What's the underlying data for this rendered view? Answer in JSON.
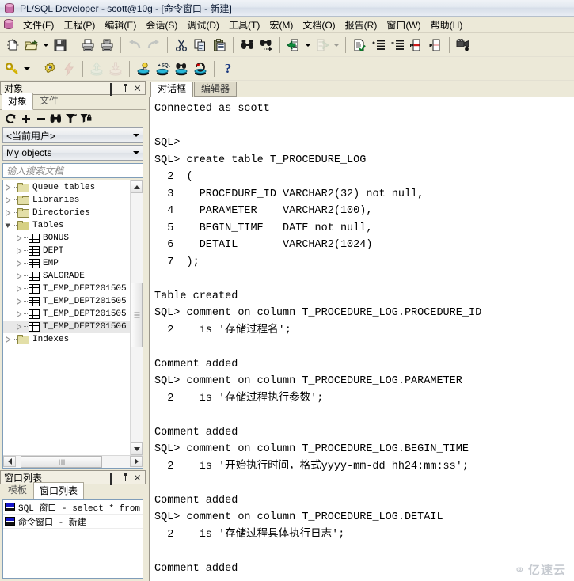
{
  "window": {
    "title": "PL/SQL Developer - scott@10g - [命令窗口 - 新建]",
    "app_icon": "database-icon"
  },
  "menubar": {
    "icon": "database-icon",
    "items": [
      {
        "label": "文件(F)",
        "name": "menu-file"
      },
      {
        "label": "工程(P)",
        "name": "menu-project"
      },
      {
        "label": "编辑(E)",
        "name": "menu-edit"
      },
      {
        "label": "会话(S)",
        "name": "menu-session"
      },
      {
        "label": "调试(D)",
        "name": "menu-debug"
      },
      {
        "label": "工具(T)",
        "name": "menu-tools"
      },
      {
        "label": "宏(M)",
        "name": "menu-macro"
      },
      {
        "label": "文档(O)",
        "name": "menu-document"
      },
      {
        "label": "报告(R)",
        "name": "menu-report"
      },
      {
        "label": "窗口(W)",
        "name": "menu-window"
      },
      {
        "label": "帮助(H)",
        "name": "menu-help"
      }
    ]
  },
  "toolbar_main": {
    "buttons": [
      {
        "name": "new-icon",
        "glyph": "new",
        "enabled": true
      },
      {
        "name": "open-icon",
        "glyph": "open",
        "enabled": true
      },
      {
        "name": "open-dropdown-arrow",
        "glyph": "caret",
        "enabled": true
      },
      {
        "name": "save-icon",
        "glyph": "save",
        "enabled": true
      },
      {
        "name": "sep",
        "glyph": "sep"
      },
      {
        "name": "print-icon",
        "glyph": "print",
        "enabled": true
      },
      {
        "name": "print-preview-icon",
        "glyph": "printpreview",
        "enabled": true
      },
      {
        "name": "sep",
        "glyph": "sep"
      },
      {
        "name": "undo-icon",
        "glyph": "undo",
        "enabled": false
      },
      {
        "name": "redo-icon",
        "glyph": "redo",
        "enabled": false
      },
      {
        "name": "sep",
        "glyph": "sep"
      },
      {
        "name": "cut-icon",
        "glyph": "cut",
        "enabled": true
      },
      {
        "name": "copy-icon",
        "glyph": "copy",
        "enabled": true
      },
      {
        "name": "paste-icon",
        "glyph": "paste",
        "enabled": true
      },
      {
        "name": "sep",
        "glyph": "sep"
      },
      {
        "name": "find-icon",
        "glyph": "find",
        "enabled": true
      },
      {
        "name": "find-next-icon",
        "glyph": "findnext",
        "enabled": true
      },
      {
        "name": "sep",
        "glyph": "sep"
      },
      {
        "name": "import-icon",
        "glyph": "import",
        "enabled": true
      },
      {
        "name": "import-dropdown-arrow",
        "glyph": "caret",
        "enabled": true
      },
      {
        "name": "export-icon",
        "glyph": "export",
        "enabled": false
      },
      {
        "name": "export-dropdown-arrow",
        "glyph": "caret",
        "enabled": false
      },
      {
        "name": "sep",
        "glyph": "sep"
      },
      {
        "name": "check-syntax-icon",
        "glyph": "checkdoc",
        "enabled": true
      },
      {
        "name": "indent-icon",
        "glyph": "indent",
        "enabled": true
      },
      {
        "name": "outdent-icon",
        "glyph": "outdent",
        "enabled": true
      },
      {
        "name": "comment-icon",
        "glyph": "commentdoc",
        "enabled": true
      },
      {
        "name": "uncomment-icon",
        "glyph": "uncommentdoc",
        "enabled": true
      },
      {
        "name": "sep",
        "glyph": "sep"
      },
      {
        "name": "record-macro-icon",
        "glyph": "camera",
        "enabled": true
      }
    ]
  },
  "toolbar_secondary": {
    "buttons": [
      {
        "name": "explain-plan-icon",
        "glyph": "key",
        "enabled": true
      },
      {
        "name": "key-dropdown-arrow",
        "glyph": "caret",
        "enabled": true
      },
      {
        "name": "sep",
        "glyph": "sep"
      },
      {
        "name": "execute-icon",
        "glyph": "gear",
        "enabled": true
      },
      {
        "name": "break-icon",
        "glyph": "bolt",
        "enabled": false
      },
      {
        "name": "sep",
        "glyph": "sep"
      },
      {
        "name": "commit-icon",
        "glyph": "commit",
        "enabled": false
      },
      {
        "name": "rollback-icon",
        "glyph": "rollback",
        "enabled": false
      },
      {
        "name": "sep",
        "glyph": "sep"
      },
      {
        "name": "explain-plan-window-icon",
        "glyph": "db-bulb",
        "enabled": true
      },
      {
        "name": "sql-window-icon",
        "glyph": "db-sql",
        "enabled": true
      },
      {
        "name": "find-database-objects-icon",
        "glyph": "db-find",
        "enabled": true
      },
      {
        "name": "session-icon",
        "glyph": "db-session",
        "enabled": true
      },
      {
        "name": "sep",
        "glyph": "sep"
      },
      {
        "name": "help-icon",
        "glyph": "question",
        "enabled": true
      }
    ]
  },
  "object_panel": {
    "caption": "对象",
    "caption_buttons": [
      "maximize-icon",
      "pin-icon",
      "close-icon"
    ],
    "tabs": [
      {
        "label": "对象",
        "selected": true
      },
      {
        "label": "文件",
        "selected": false
      }
    ],
    "toolbar": [
      {
        "name": "refresh-icon",
        "glyph": "refresh"
      },
      {
        "name": "expand-icon",
        "glyph": "plus"
      },
      {
        "name": "collapse-icon",
        "glyph": "minus"
      },
      {
        "name": "find-icon",
        "glyph": "binoculars"
      },
      {
        "name": "filter-icon",
        "glyph": "filter"
      },
      {
        "name": "lock-filter-icon",
        "glyph": "filter-lock"
      }
    ],
    "user_combo": "<当前用户>",
    "filter_combo": "My objects",
    "search_placeholder": "输入搜索文档",
    "tree": [
      {
        "label": "Queue tables",
        "icon": "folder-icon",
        "indent": 0,
        "expanded": false
      },
      {
        "label": "Libraries",
        "icon": "folder-icon",
        "indent": 0,
        "expanded": false
      },
      {
        "label": "Directories",
        "icon": "folder-icon",
        "indent": 0,
        "expanded": false
      },
      {
        "label": "Tables",
        "icon": "folder-open-icon",
        "indent": 0,
        "expanded": true
      },
      {
        "label": "BONUS",
        "icon": "table-icon",
        "indent": 1,
        "expanded": false
      },
      {
        "label": "DEPT",
        "icon": "table-icon",
        "indent": 1,
        "expanded": false
      },
      {
        "label": "EMP",
        "icon": "table-icon",
        "indent": 1,
        "expanded": false
      },
      {
        "label": "SALGRADE",
        "icon": "table-icon",
        "indent": 1,
        "expanded": false
      },
      {
        "label": "T_EMP_DEPT201505",
        "icon": "table-icon",
        "indent": 1,
        "expanded": false
      },
      {
        "label": "T_EMP_DEPT201505",
        "icon": "table-icon",
        "indent": 1,
        "expanded": false
      },
      {
        "label": "T_EMP_DEPT201505",
        "icon": "table-icon",
        "indent": 1,
        "expanded": false
      },
      {
        "label": "T_EMP_DEPT201506",
        "icon": "table-icon",
        "indent": 1,
        "expanded": false,
        "selected": true
      },
      {
        "label": "Indexes",
        "icon": "folder-icon",
        "indent": 0,
        "expanded": false
      }
    ]
  },
  "window_list_panel": {
    "caption": "窗口列表",
    "caption_buttons": [
      "maximize-icon",
      "pin-icon",
      "close-icon"
    ],
    "tabs": [
      {
        "label": "模板",
        "selected": false
      },
      {
        "label": "窗口列表",
        "selected": true
      }
    ],
    "items": [
      {
        "label": "SQL 窗口 - select * from t_",
        "icon": "window-icon"
      },
      {
        "label": "命令窗口 - 新建",
        "icon": "window-icon"
      }
    ]
  },
  "editor": {
    "tabs": [
      {
        "label": "对话框",
        "selected": true
      },
      {
        "label": "编辑器",
        "selected": false
      }
    ],
    "console_lines": [
      "Connected as scott",
      "",
      "SQL>",
      "SQL> create table T_PROCEDURE_LOG",
      "  2  (",
      "  3    PROCEDURE_ID VARCHAR2(32) not null,",
      "  4    PARAMETER    VARCHAR2(100),",
      "  5    BEGIN_TIME   DATE not null,",
      "  6    DETAIL       VARCHAR2(1024)",
      "  7  );",
      "",
      "Table created",
      "SQL> comment on column T_PROCEDURE_LOG.PROCEDURE_ID",
      "  2    is '存储过程名';",
      "",
      "Comment added",
      "SQL> comment on column T_PROCEDURE_LOG.PARAMETER",
      "  2    is '存储过程执行参数';",
      "",
      "Comment added",
      "SQL> comment on column T_PROCEDURE_LOG.BEGIN_TIME",
      "  2    is '开始执行时间，格式yyyy-mm-dd hh24:mm:ss';",
      "",
      "Comment added",
      "SQL> comment on column T_PROCEDURE_LOG.DETAIL",
      "  2    is '存储过程具体执行日志';",
      "",
      "Comment added"
    ],
    "watermark": "亿速云"
  },
  "colors": {
    "desktop": "#ece9d8",
    "panel_border": "#9a968a",
    "console_bg": "#ffffff",
    "title_text": "#0b1a33",
    "accent_blue": "#1515c8"
  }
}
